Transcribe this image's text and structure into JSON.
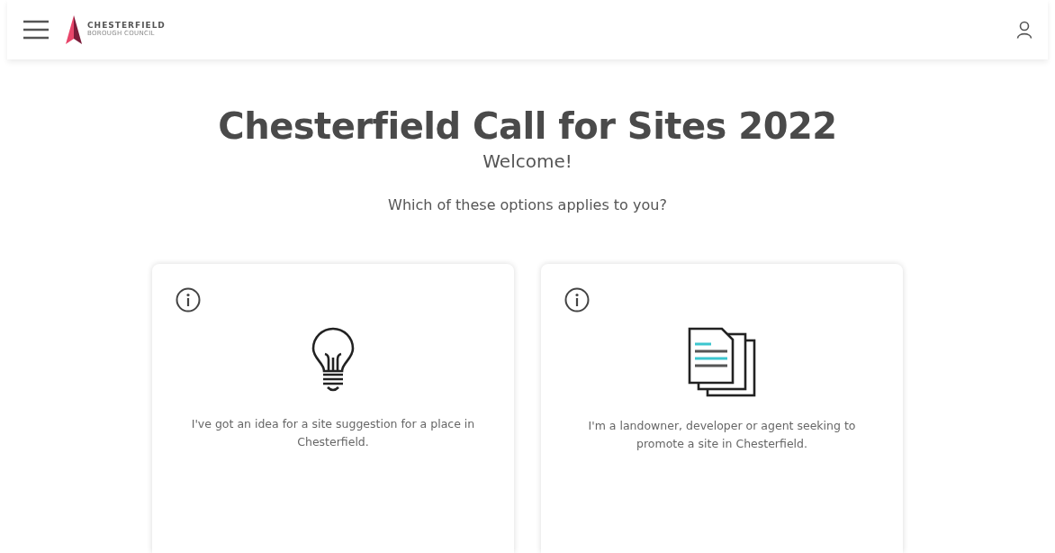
{
  "header": {
    "logo_name": "CHESTERFIELD",
    "logo_subtitle": "BOROUGH COUNCIL"
  },
  "title": "Chesterfield Call for Sites 2022",
  "welcome": "Welcome!",
  "question": "Which of these options applies to you?",
  "options": [
    {
      "kind": "idea",
      "text": "I've got an idea for a site suggestion for a place in Chesterfield."
    },
    {
      "kind": "documents",
      "text": "I'm a landowner, developer or agent seeking to promote a site in Chesterfield."
    }
  ]
}
